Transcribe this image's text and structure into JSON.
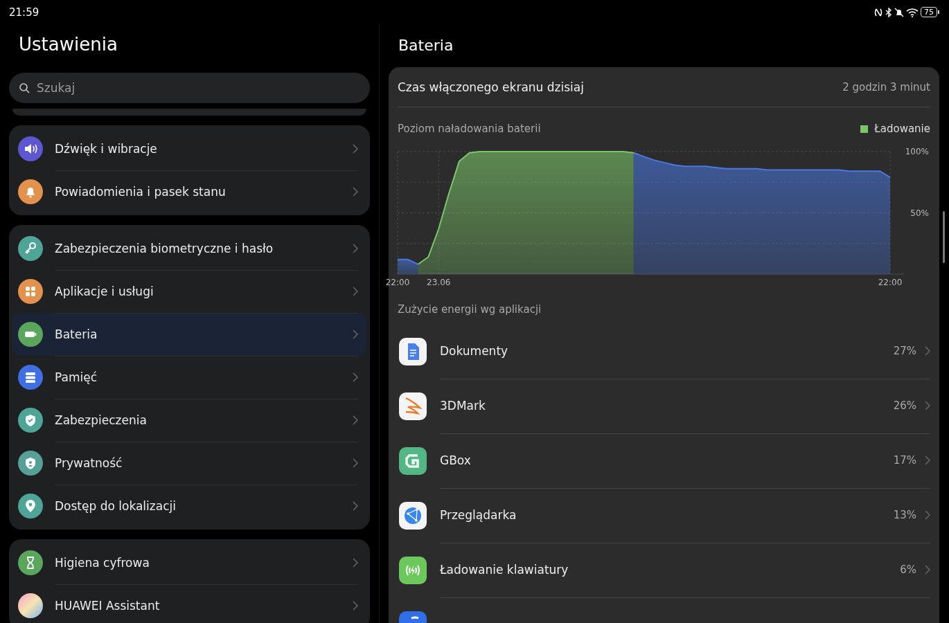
{
  "status_bar": {
    "time": "21:59",
    "battery": "75"
  },
  "sidebar": {
    "title": "Ustawienia",
    "search": {
      "placeholder": "Szukaj"
    },
    "groups": [
      {
        "items": [
          {
            "label": "Dźwięk i wibracje",
            "kind": "sound",
            "selected": false
          },
          {
            "label": "Powiadomienia i pasek stanu",
            "kind": "bell",
            "selected": false
          }
        ]
      },
      {
        "items": [
          {
            "label": "Zabezpieczenia biometryczne i hasło",
            "kind": "key",
            "selected": false
          },
          {
            "label": "Aplikacje i usługi",
            "kind": "apps",
            "selected": false
          },
          {
            "label": "Bateria",
            "kind": "battery",
            "selected": true
          },
          {
            "label": "Pamięć",
            "kind": "storage",
            "selected": false
          },
          {
            "label": "Zabezpieczenia",
            "kind": "shield",
            "selected": false
          },
          {
            "label": "Prywatność",
            "kind": "privacy",
            "selected": false
          },
          {
            "label": "Dostęp do lokalizacji",
            "kind": "location",
            "selected": false
          }
        ]
      },
      {
        "items": [
          {
            "label": "Higiena cyfrowa",
            "kind": "hourglass",
            "selected": false
          },
          {
            "label": "HUAWEI Assistant",
            "kind": "assistant",
            "selected": false
          }
        ]
      }
    ]
  },
  "detail": {
    "title": "Bateria",
    "screen_time": {
      "label": "Czas włączonego ekranu dzisiaj",
      "value": "2 godzin 3 minut"
    },
    "chart": {
      "title": "Poziom naładowania baterii",
      "chart_data": {
        "type": "area",
        "categories": [
          "22:00",
          null,
          null,
          null,
          "23.06",
          null,
          null,
          null,
          null,
          null,
          null,
          null,
          null,
          null,
          null,
          null,
          null,
          null,
          null,
          null,
          null,
          null,
          null,
          null,
          null,
          null,
          null,
          null,
          null,
          null,
          null,
          null,
          null,
          null,
          null,
          null,
          null,
          null,
          null,
          null,
          null,
          null,
          null,
          null,
          null,
          null,
          null,
          null,
          "22:00"
        ],
        "series": [
          {
            "color": "#4a78e0",
            "values": [
              12,
              12,
              8,
              null,
              null,
              null,
              null,
              null,
              null,
              null,
              null,
              null,
              null,
              null,
              null,
              null,
              null,
              null,
              null,
              null,
              null,
              null,
              null,
              99,
              96,
              93,
              91,
              89,
              88,
              88,
              88,
              87,
              86,
              86,
              86,
              86,
              85,
              85,
              85,
              85,
              85,
              85,
              85,
              85,
              84,
              84,
              84,
              84,
              79
            ]
          },
          {
            "name": "Ładowanie",
            "color": "#7cc66a",
            "values": [
              null,
              null,
              8,
              14,
              37,
              66,
              92,
              99,
              100,
              100,
              100,
              100,
              100,
              100,
              100,
              100,
              100,
              100,
              100,
              100,
              100,
              100,
              100,
              99,
              null,
              null,
              null,
              null,
              null,
              null,
              null,
              null,
              null,
              null,
              null,
              null,
              null,
              null,
              null,
              null,
              null,
              null,
              null,
              null,
              null,
              null,
              null,
              null,
              null
            ]
          }
        ],
        "ylim": [
          0,
          100
        ],
        "yticks": [
          {
            "value": 100,
            "label": "100%"
          },
          {
            "value": 50,
            "label": "50%"
          }
        ]
      }
    },
    "apps_title": "Zużycie energii wg aplikacji",
    "apps": [
      {
        "name": "Dokumenty",
        "percent": "27%",
        "kind": "docs"
      },
      {
        "name": "3DMark",
        "percent": "26%",
        "kind": "mark"
      },
      {
        "name": "GBox",
        "percent": "17%",
        "kind": "gbox"
      },
      {
        "name": "Przeglądarka",
        "percent": "13%",
        "kind": "browser"
      },
      {
        "name": "Ładowanie klawiatury",
        "percent": "6%",
        "kind": "charging"
      },
      {
        "kind": "partial"
      }
    ]
  }
}
